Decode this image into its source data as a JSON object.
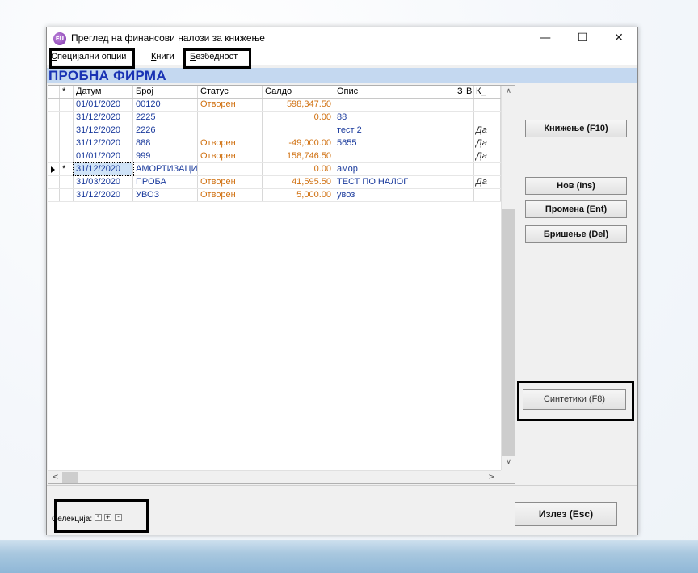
{
  "window": {
    "title": "Преглед на финансови налози за книжење",
    "app_icon_label": "EU",
    "minimize_glyph": "—",
    "maximize_glyph": "☐",
    "close_glyph": "✕"
  },
  "menu": {
    "items": [
      {
        "label": "Специјални опции",
        "accel": "С",
        "rest": "пецијални опции"
      },
      {
        "label": "Книги",
        "accel": "К",
        "rest": "ниги"
      },
      {
        "label": "Безбедност",
        "accel": "Б",
        "rest": "езбедност"
      }
    ]
  },
  "company": {
    "name": "ПРОБНА ФИРМА"
  },
  "grid": {
    "columns": {
      "flag": "*",
      "date": "Датум",
      "num": "Број",
      "status": "Статус",
      "saldo": "Салдо",
      "opis": "Опис",
      "z": "З",
      "v": "В",
      "k": "К_"
    },
    "rows": [
      {
        "flag": "",
        "date": "01/01/2020",
        "num": "00120",
        "status": "Отворен",
        "saldo": "598,347.50",
        "opis": "",
        "z": "",
        "v": "",
        "k": ""
      },
      {
        "flag": "",
        "date": "31/12/2020",
        "num": "2225",
        "status": "",
        "saldo": "0.00",
        "opis": "88",
        "z": "",
        "v": "",
        "k": ""
      },
      {
        "flag": "",
        "date": "31/12/2020",
        "num": "2226",
        "status": "",
        "saldo": "",
        "opis": "тест 2",
        "z": "",
        "v": "",
        "k": "Да"
      },
      {
        "flag": "",
        "date": "31/12/2020",
        "num": "888",
        "status": "Отворен",
        "saldo": "-49,000.00",
        "opis": "5655",
        "z": "",
        "v": "",
        "k": "Да"
      },
      {
        "flag": "",
        "date": "01/01/2020",
        "num": "999",
        "status": "Отворен",
        "saldo": "158,746.50",
        "opis": "",
        "z": "",
        "v": "",
        "k": "Да"
      },
      {
        "flag": "*",
        "date": "31/12/2020",
        "num": "АМОРТИЗАЦИ",
        "status": "",
        "saldo": "0.00",
        "opis": "амор",
        "z": "",
        "v": "",
        "k": ""
      },
      {
        "flag": "",
        "date": "31/03/2020",
        "num": "ПРОБА",
        "status": "Отворен",
        "saldo": "41,595.50",
        "opis": "ТЕСТ ПО НАЛОГ",
        "z": "",
        "v": "",
        "k": "Да"
      },
      {
        "flag": "",
        "date": "31/12/2020",
        "num": "УВОЗ",
        "status": "Отворен",
        "saldo": "5,000.00",
        "opis": "увоз",
        "z": "",
        "v": "",
        "k": ""
      }
    ],
    "current_row": 5,
    "scroll_up": "∧",
    "scroll_down": "∨",
    "scroll_left": "<",
    "scroll_right": ">"
  },
  "buttons": {
    "knizenje": "Книжење (F10)",
    "nov": "Нов (Ins)",
    "promena": "Промена (Ent)",
    "brisenje": "Бришење (Del)",
    "sintetiki": "Синтетики (F8)",
    "izlez": "Излез (Esc)"
  },
  "selection": {
    "label": "Селекција:",
    "all": "*",
    "plus": "+",
    "minus": "-"
  }
}
